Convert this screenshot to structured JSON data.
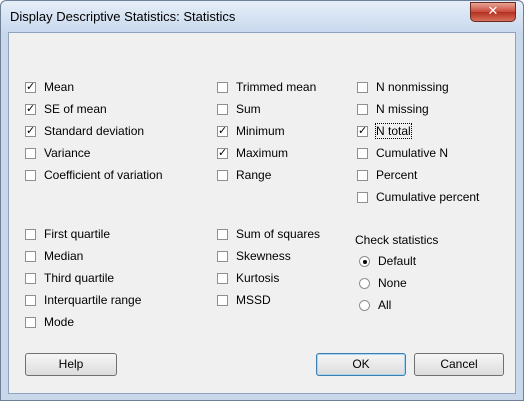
{
  "window": {
    "title": "Display Descriptive Statistics: Statistics",
    "close_glyph": "✕"
  },
  "col1": [
    {
      "label": "Mean",
      "checked": true
    },
    {
      "label": "SE of mean",
      "checked": true
    },
    {
      "label": "Standard deviation",
      "checked": true
    },
    {
      "label": "Variance",
      "checked": false
    },
    {
      "label": "Coefficient of variation",
      "checked": false
    }
  ],
  "col2": [
    {
      "label": "Trimmed mean",
      "checked": false
    },
    {
      "label": "Sum",
      "checked": false
    },
    {
      "label": "Minimum",
      "checked": true
    },
    {
      "label": "Maximum",
      "checked": true
    },
    {
      "label": "Range",
      "checked": false
    }
  ],
  "col3": [
    {
      "label": "N nonmissing",
      "checked": false
    },
    {
      "label": "N missing",
      "checked": false
    },
    {
      "label": "N total",
      "checked": true
    },
    {
      "label": "Cumulative N",
      "checked": false
    },
    {
      "label": "Percent",
      "checked": false
    },
    {
      "label": "Cumulative percent",
      "checked": false
    }
  ],
  "col1b": [
    {
      "label": "First quartile",
      "checked": false
    },
    {
      "label": "Median",
      "checked": false
    },
    {
      "label": "Third quartile",
      "checked": false
    },
    {
      "label": "Interquartile range",
      "checked": false
    },
    {
      "label": "Mode",
      "checked": false
    }
  ],
  "col2b": [
    {
      "label": "Sum of squares",
      "checked": false
    },
    {
      "label": "Skewness",
      "checked": false
    },
    {
      "label": "Kurtosis",
      "checked": false
    },
    {
      "label": "MSSD",
      "checked": false
    }
  ],
  "check_statistics": {
    "title": "Check statistics",
    "options": [
      "Default",
      "None",
      "All"
    ],
    "selected": "Default"
  },
  "buttons": {
    "help": "Help",
    "ok": "OK",
    "cancel": "Cancel"
  }
}
